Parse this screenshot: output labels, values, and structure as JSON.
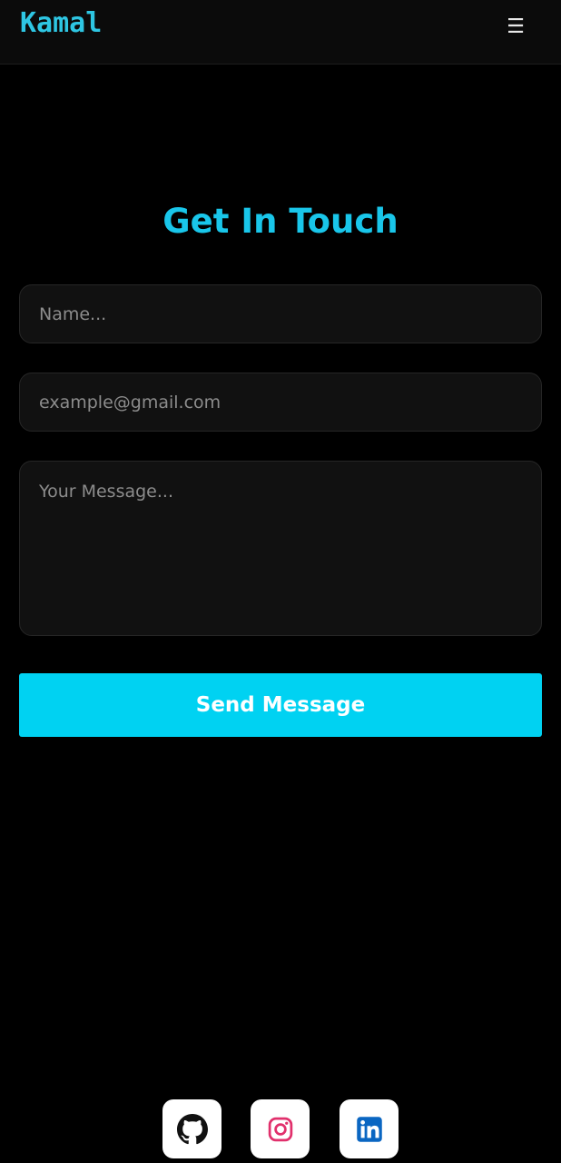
{
  "navbar": {
    "logo": "Kamal",
    "menu_icon": "hamburger-menu-icon",
    "menu_glyph": "☰"
  },
  "contact": {
    "title": "Get In Touch",
    "name_placeholder": "Name...",
    "email_placeholder": "example@gmail.com",
    "message_placeholder": "Your Message...",
    "send_label": "Send Message"
  },
  "social": [
    {
      "icon": "github-icon",
      "color": "#111111"
    },
    {
      "icon": "instagram-icon",
      "color": "#e1306c"
    },
    {
      "icon": "linkedin-icon",
      "color": "#0a66c2"
    }
  ],
  "colors": {
    "accent": "#19c6ea",
    "button": "#00d2f2",
    "background": "#000000",
    "field_background": "#111111"
  }
}
